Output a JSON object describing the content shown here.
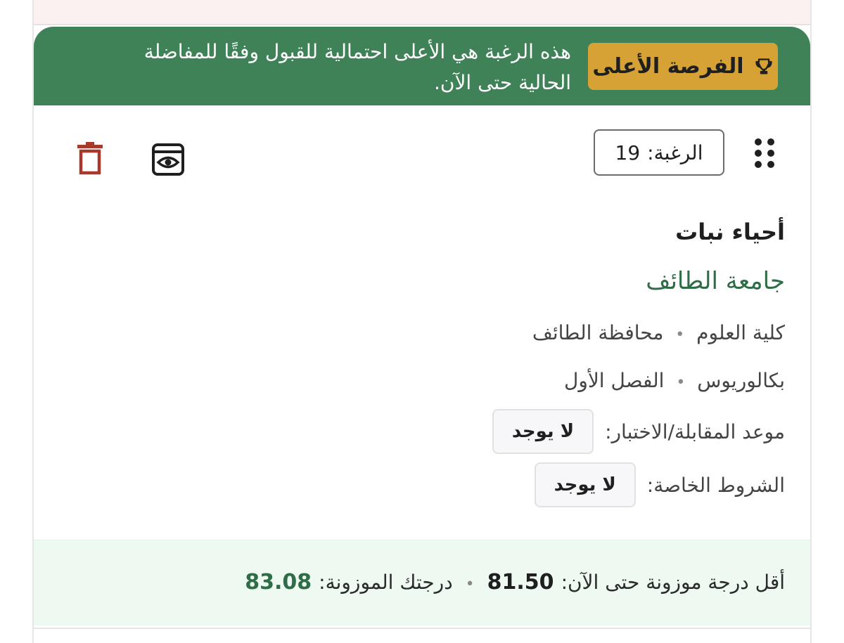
{
  "banner": {
    "badge_label": "الفرصة الأعلى",
    "message": "هذه الرغبة هي الأعلى احتمالية للقبول وفقًا للمفاضلة الحالية حتى الآن.",
    "background_color": "#3f8258",
    "badge_color": "#d6a236"
  },
  "toolbar": {
    "wish_label": "الرغبة:",
    "wish_number": "19"
  },
  "program": {
    "major": "أحياء نبات",
    "university": "جامعة الطائف",
    "college": "كلية العلوم",
    "location": "محافظة الطائف",
    "degree": "بكالوريوس",
    "semester": "الفصل الأول",
    "separator": "•"
  },
  "details": {
    "interview_label": "موعد المقابلة/الاختبار:",
    "interview_value": "لا يوجد",
    "conditions_label": "الشروط الخاصة:",
    "conditions_value": "لا يوجد"
  },
  "scores": {
    "min_label": "أقل درجة موزونة حتى الآن:",
    "min_value": "81.50",
    "separator": "•",
    "mine_label": "درجتك الموزونة:",
    "mine_value": "83.08"
  },
  "icons": {
    "badge": "trophy-icon",
    "drag": "drag-handle-icon",
    "view": "eye-icon",
    "delete": "trash-icon"
  },
  "colors": {
    "university_text": "#2f6d46",
    "trash": "#a8382b",
    "footer_bg": "#eefaf1"
  }
}
